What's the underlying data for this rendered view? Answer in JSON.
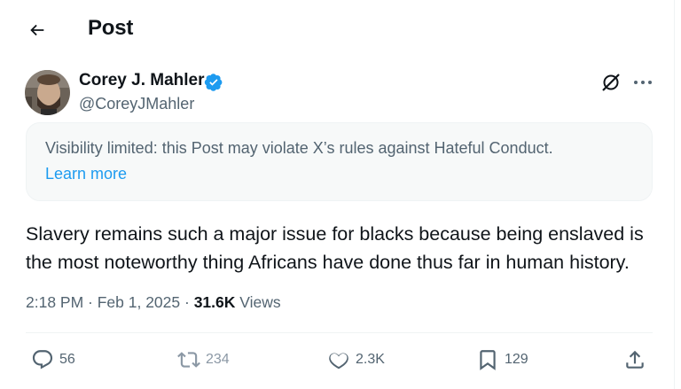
{
  "header": {
    "title": "Post"
  },
  "author": {
    "name": "Corey J. Mahler",
    "handle": "@CoreyJMahler"
  },
  "notice": {
    "text": "Visibility limited: this Post may violate X’s rules against Hateful Conduct.",
    "link": "Learn more"
  },
  "post": {
    "lines": [
      "Slavery remains such a major issue for blacks because being enslaved is",
      "the most noteworthy thing Africans have done thus far in human history."
    ]
  },
  "meta": {
    "timestamp": "2:18 PM · Feb 1, 2025 · ",
    "views_count": "31.6K",
    "views_label": " Views"
  },
  "actions": {
    "replies": "56",
    "reposts": "234",
    "likes": "2.3K",
    "bookmarks": "129"
  },
  "colors": {
    "accent": "#1d9bf0",
    "secondary_text": "#536471",
    "verified": "#1d9bf0"
  },
  "icons": [
    "back-arrow-icon",
    "verified-badge-icon",
    "grok-icon",
    "more-icon",
    "reply-icon",
    "repost-icon",
    "like-icon",
    "bookmark-icon",
    "share-icon"
  ]
}
